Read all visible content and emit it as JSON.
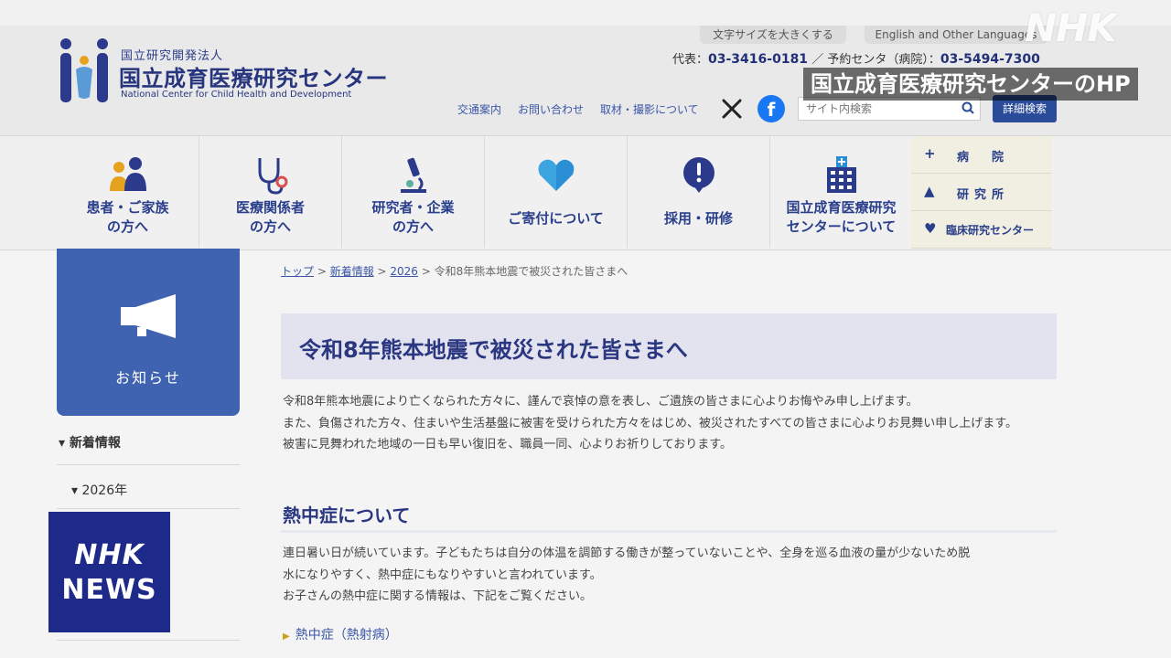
{
  "header": {
    "org_type": "国立研究開発法人",
    "org_name": "国立成育医療研究センター",
    "org_name_en": "National Center for Child Health and Development",
    "font_size_link": "文字サイズを大きくする",
    "language_link": "English and Other Languages",
    "phone_main_label": "代表：",
    "phone_main": "03-3416-0181",
    "phone_sep": "／ 予約センタ（病院）：",
    "phone_reserve": "03-5494-7300",
    "links": [
      "交通案内",
      "お問い合わせ",
      "取材・撮影について"
    ],
    "search_placeholder": "サイト内検索",
    "search_button": "詳細検索"
  },
  "overlay": {
    "broadcaster": "NHK",
    "caption": "国立成育医療研究センターのHP",
    "news_logo_top": "NHK",
    "news_logo_bottom": "NEWS"
  },
  "nav": {
    "items": [
      {
        "line1": "患者・ご家族",
        "line2": "の方へ"
      },
      {
        "line1": "医療関係者",
        "line2": "の方へ"
      },
      {
        "line1": "研究者・企業",
        "line2": "の方へ"
      },
      {
        "line1": "ご寄付について",
        "line2": ""
      },
      {
        "line1": "採用・研修",
        "line2": ""
      },
      {
        "line1": "国立成育医療研究",
        "line2": "センターについて"
      }
    ],
    "side": [
      {
        "mark": "+",
        "label": "病　院"
      },
      {
        "mark": "▲",
        "label": "研究所"
      },
      {
        "mark": "♥",
        "label": "臨床研究センター"
      }
    ]
  },
  "sidebar": {
    "notice_label": "お知らせ",
    "news": "新着情報",
    "year": "2026年"
  },
  "breadcrumb": {
    "top": "トップ",
    "news": "新着情報",
    "year": "2026",
    "current": "令和8年熊本地震で被災された皆さまへ",
    "sep": " > "
  },
  "article": {
    "title": "令和8年熊本地震で被災された皆さまへ",
    "p1": "令和8年熊本地震により亡くなられた方々に、謹んで哀悼の意を表し、ご遺族の皆さまに心よりお悔やみ申し上げます。",
    "p2": "また、負傷された方々、住まいや生活基盤に被害を受けられた方々をはじめ、被災されたすべての皆さまに心よりお見舞い申し上げます。",
    "p3": "被害に見舞われた地域の一日も早い復旧を、職員一同、心よりお祈りしております。",
    "h2": "熱中症について",
    "heat1": "連日暑い日が続いています。子どもたちは自分の体温を調節する働きが整っていないことや、全身を巡る血液の量が少ないため脱",
    "heat2": "水になりやすく、熱中症にもなりやすいと言われています。",
    "heat3": "お子さんの熱中症に関する情報は、下記をご覧ください。",
    "link": "熱中症（熱射病）"
  },
  "colors": {
    "brand_navy": "#26357e",
    "notice_blue": "#3f63b0",
    "nhk_blue": "#1d2a8a",
    "link_blue": "#3a56a8"
  }
}
